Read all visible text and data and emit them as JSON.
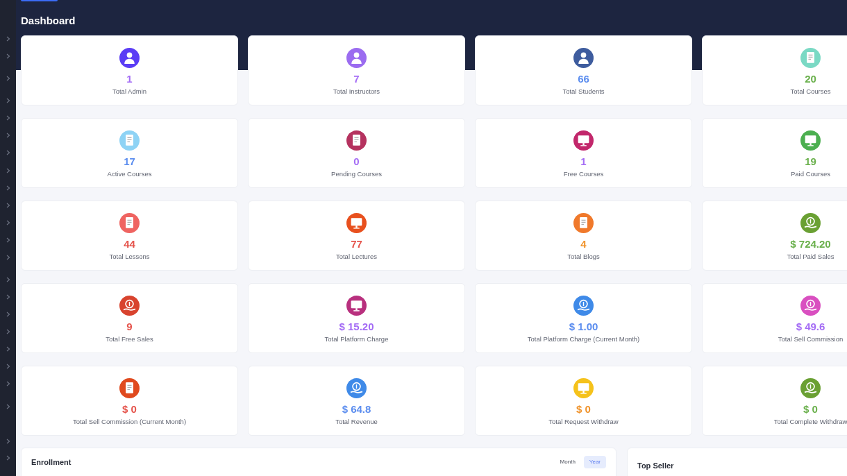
{
  "page_title": "Dashboard",
  "cards": [
    {
      "value": "1",
      "label": "Total Admin",
      "color": "#a46cf5",
      "kind": "person"
    },
    {
      "value": "7",
      "label": "Total Instructors",
      "color": "#a46cf5",
      "kind": "person"
    },
    {
      "value": "66",
      "label": "Total Students",
      "color": "#5b8def",
      "kind": "person"
    },
    {
      "value": "20",
      "label": "Total Courses",
      "color": "#6ab04c",
      "kind": "document"
    },
    {
      "value": "17",
      "label": "Active Courses",
      "color": "#5b8def",
      "kind": "document"
    },
    {
      "value": "0",
      "label": "Pending Courses",
      "color": "#a46cf5",
      "kind": "document"
    },
    {
      "value": "1",
      "label": "Free Courses",
      "color": "#a46cf5",
      "kind": "monitor"
    },
    {
      "value": "19",
      "label": "Paid Courses",
      "color": "#6ab04c",
      "kind": "monitor"
    },
    {
      "value": "44",
      "label": "Total Lessons",
      "color": "#e5534b",
      "kind": "document"
    },
    {
      "value": "77",
      "label": "Total Lectures",
      "color": "#e5534b",
      "kind": "monitor"
    },
    {
      "value": "4",
      "label": "Total Blogs",
      "color": "#f0932b",
      "kind": "document"
    },
    {
      "value": "$ 724.20",
      "label": "Total Paid Sales",
      "color": "#6ab04c",
      "kind": "money"
    },
    {
      "value": "9",
      "label": "Total Free Sales",
      "color": "#e5534b",
      "kind": "money"
    },
    {
      "value": "$ 15.20",
      "label": "Total Platform Charge",
      "color": "#a46cf5",
      "kind": "monitor"
    },
    {
      "value": "$ 1.00",
      "label": "Total Platform Charge (Current Month)",
      "color": "#5b8def",
      "kind": "money"
    },
    {
      "value": "$ 49.6",
      "label": "Total Sell Commission",
      "color": "#a46cf5",
      "kind": "money"
    },
    {
      "value": "$ 0",
      "label": "Total Sell Commission (Current Month)",
      "color": "#e5534b",
      "kind": "document"
    },
    {
      "value": "$ 64.8",
      "label": "Total Revenue",
      "color": "#5b8def",
      "kind": "money"
    },
    {
      "value": "$ 0",
      "label": "Total Request Withdraw",
      "color": "#f0932b",
      "kind": "monitor"
    },
    {
      "value": "$ 0",
      "label": "Total Complete Withdraw",
      "color": "#6ab04c",
      "kind": "money"
    }
  ],
  "enrollment": {
    "title": "Enrollment",
    "toggle": [
      {
        "label": "Month",
        "selected": false
      },
      {
        "label": "Year",
        "selected": true
      }
    ]
  },
  "top_seller": {
    "title": "Top Seller"
  }
}
